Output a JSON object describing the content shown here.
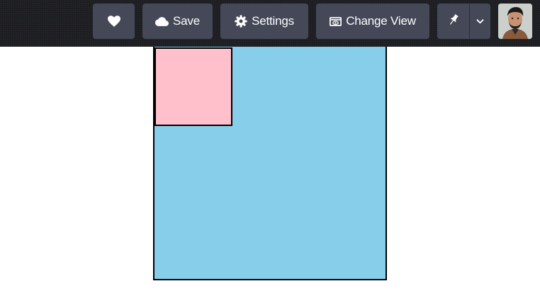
{
  "toolbar": {
    "like": {
      "icon": "heart-icon"
    },
    "save": {
      "icon": "cloud-icon",
      "label": "Save"
    },
    "settings": {
      "icon": "gear-icon",
      "label": "Settings"
    },
    "change_view": {
      "icon": "view-icon",
      "label": "Change View"
    },
    "pin": {
      "icon": "pin-icon"
    },
    "menu": {
      "icon": "chevron-down-icon"
    },
    "avatar": {
      "icon": "user-avatar"
    }
  },
  "canvas": {
    "outer_box_color": "#87ceeb",
    "inner_box_color": "#ffc0cb",
    "border_color": "#000000"
  },
  "colors": {
    "topbar": "#1d1e22",
    "button": "#444857",
    "button_text": "#ffffff"
  }
}
